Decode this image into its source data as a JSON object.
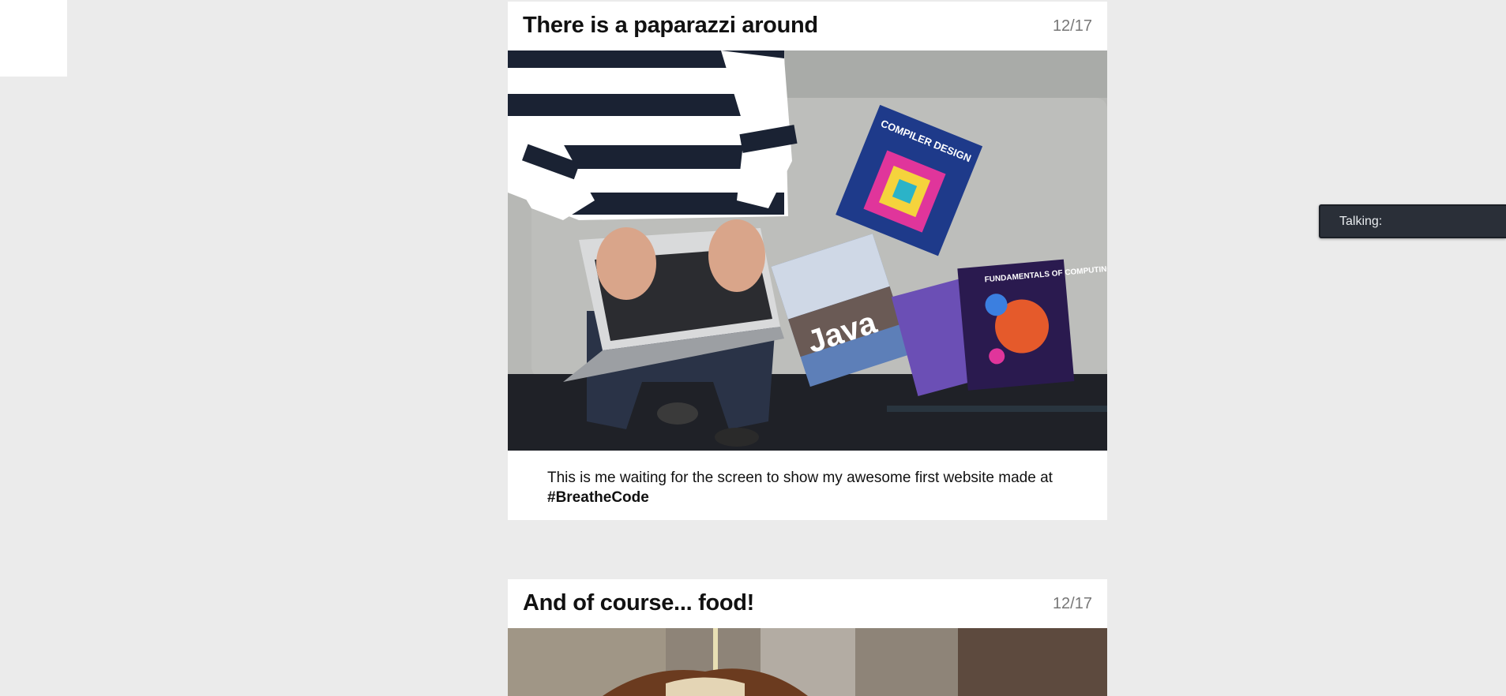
{
  "posts": [
    {
      "title": "There is a paparazzi around",
      "date": "12/17",
      "image_alt": "",
      "caption_text": "This is me waiting for the screen to show my awesome first website made at ",
      "caption_tag": "#BreatheCode",
      "book_titles": {
        "compiler": "COMPILER DESIGN",
        "java": "Java",
        "fundamentals": "FUNDAMENTALS OF COMPUTING II"
      }
    },
    {
      "title": "And of course... food!",
      "date": "12/17"
    }
  ],
  "chat": {
    "label": "Talking:"
  },
  "colors": {
    "page_background": "#ebebeb",
    "card_background": "#ffffff",
    "chat_background": "#2a2f38"
  }
}
